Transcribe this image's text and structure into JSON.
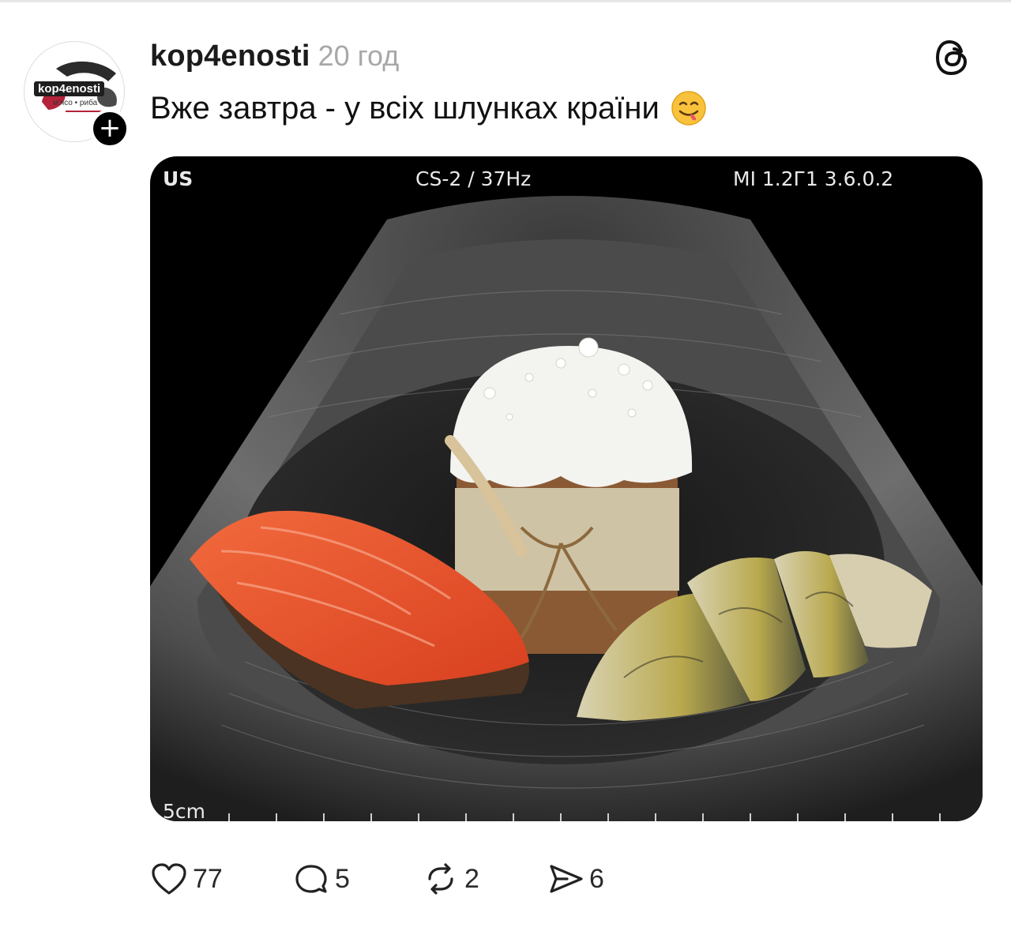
{
  "post": {
    "username": "kop4enosti",
    "timestamp": "20 год",
    "caption": "Вже завтра - у всіх шлунках країни",
    "avatar_logo": "kop4enosti",
    "avatar_tagline": "м'ясо • риба"
  },
  "media": {
    "top_left_label": "US",
    "mode_label": "CS-2 / 37Hz",
    "mi_label": "MI 1.2Г1 3.6.0.2",
    "scale_label": "5cm"
  },
  "actions": {
    "likes": "77",
    "replies": "5",
    "reposts": "2",
    "shares": "6"
  },
  "icons": {
    "threads": "threads-logo-icon",
    "follow": "plus-icon",
    "like": "heart-icon",
    "reply": "speech-bubble-icon",
    "repost": "repost-icon",
    "share": "paper-plane-icon",
    "emoji": "face-savoring-food-emoji"
  }
}
